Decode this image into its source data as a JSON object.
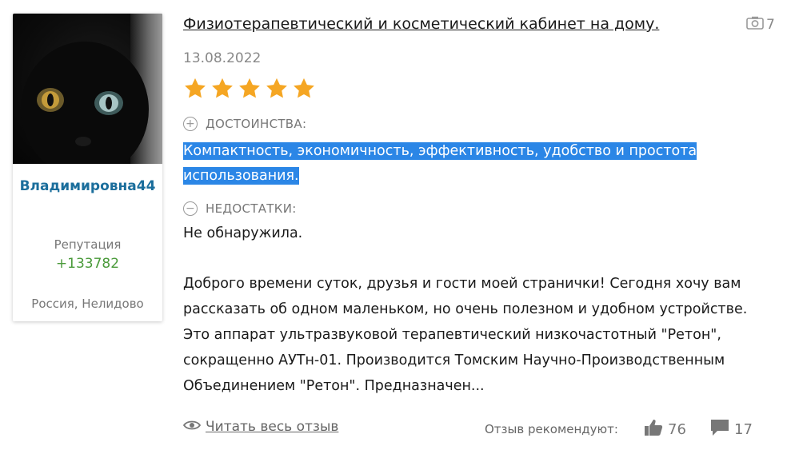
{
  "user": {
    "name": "Владимировна44",
    "reputation_label": "Репутация",
    "reputation_value": "+133782",
    "location": "Россия, Нелидово"
  },
  "review": {
    "title": "Физиотерапевтический и косметический кабинет на дому.",
    "photo_count": "7",
    "date": "13.08.2022",
    "rating": 5,
    "rating_max": 5,
    "pros_label": "ДОСТОИНСТВА:",
    "pros_text": "Компактность, экономичность, эффективность, удобство и простота использования.",
    "cons_label": "НЕДОСТАТКИ:",
    "cons_text": "Не обнаружила.",
    "body": "Доброго времени суток, друзья и гости моей странички! Сегодня хочу вам рассказать об одном маленьком, но очень полезном и удобном устройстве. Это аппарат ультразвуковой терапевтический низкочастотный \"Ретон\", сокращенно АУТн-01. Производится Томским Научно-Производственным Объединением \"Ретон\". Предназначен...",
    "read_more": "Читать весь отзыв",
    "recommend_label": "Отзыв рекомендуют:",
    "likes": "76",
    "comments": "17"
  },
  "colors": {
    "username": "#1b6e9c",
    "reputation": "#4a9a3a",
    "star": "#f5a623",
    "highlight": "#2b86e6"
  },
  "icons": [
    "camera-icon",
    "star-icon",
    "plus-icon",
    "minus-icon",
    "eye-icon",
    "thumbs-up-icon",
    "comment-icon"
  ]
}
